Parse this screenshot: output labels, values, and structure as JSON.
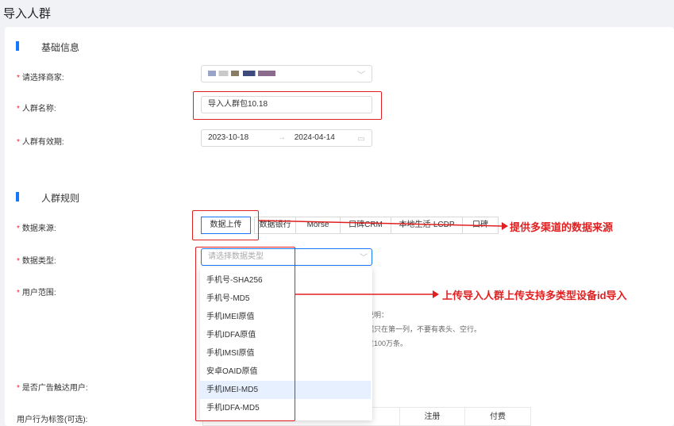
{
  "page": {
    "title": "导入人群"
  },
  "basic": {
    "section_title": "基础信息",
    "merchant_label": "请选择商家:",
    "name_label": "人群名称:",
    "name_value": "导入人群包10.18",
    "validity_label": "人群有效期:",
    "date_start": "2023-10-18",
    "date_sep": "→",
    "date_end": "2024-04-14"
  },
  "rules": {
    "section_title": "人群规则",
    "source_label": "数据来源:",
    "source_tabs": [
      "数据上传",
      "数据银行",
      "Morse",
      "口碑CRM",
      "本地生活-LCDP",
      "口碑"
    ],
    "type_label": "数据类型:",
    "type_placeholder": "请选择数据类型",
    "type_options": [
      "手机号-SHA256",
      "手机号-MD5",
      "手机IMEI原值",
      "手机IDFA原值",
      "手机IMSI原值",
      "安卓OAID原值",
      "手机IMEI-MD5",
      "手机IDFA-MD5"
    ],
    "scope_label": "用户范围:",
    "hint_lines": [
      "说明：",
      "据只在第一列，不要有表头、空行。",
      "过100万条。"
    ],
    "ad_reach_label": "是否广告触达用户:",
    "behavior_label": "用户行为标签(可选):",
    "behavior_cols": [
      "注册",
      "付费"
    ]
  },
  "annotations": {
    "source_note": "提供多渠道的数据来源",
    "type_note": "上传导入人群上传支持多类型设备id导入"
  },
  "colors": {
    "accent": "#1677ff",
    "annotation": "#e02020",
    "required": "#f5222d"
  }
}
